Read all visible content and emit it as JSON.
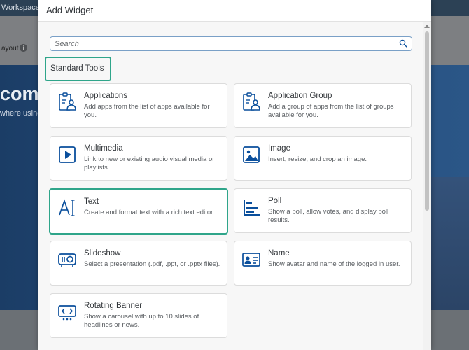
{
  "background": {
    "workspace_label": "Workspace",
    "layout_label": "ayout",
    "welcome_text": "come",
    "sub_text": "where using"
  },
  "dialog": {
    "title": "Add Widget",
    "search_placeholder": "Search",
    "section_title": "Standard Tools",
    "tiles": [
      {
        "icon": "applications-icon",
        "title": "Applications",
        "desc": "Add apps from the list of apps available for you."
      },
      {
        "icon": "application-group-icon",
        "title": "Application Group",
        "desc": "Add a group of apps from the list of groups available for you."
      },
      {
        "icon": "multimedia-icon",
        "title": "Multimedia",
        "desc": "Link to new or existing audio visual media or playlists."
      },
      {
        "icon": "image-icon",
        "title": "Image",
        "desc": "Insert, resize, and crop an image."
      },
      {
        "icon": "text-icon",
        "title": "Text",
        "desc": "Create and format text with a rich text editor."
      },
      {
        "icon": "poll-icon",
        "title": "Poll",
        "desc": "Show a poll, allow votes, and display poll results."
      },
      {
        "icon": "slideshow-icon",
        "title": "Slideshow",
        "desc": "Select a presentation (.pdf, .ppt, or .pptx files)."
      },
      {
        "icon": "name-icon",
        "title": "Name",
        "desc": "Show avatar and name of the logged in user."
      },
      {
        "icon": "rotating-banner-icon",
        "title": "Rotating Banner",
        "desc": "Show a carousel with up to 10 slides of headlines or news."
      }
    ]
  },
  "colors": {
    "accent_icon": "#0a4f9c",
    "highlight": "#2fa58a",
    "header_bar": "#2c4155"
  }
}
